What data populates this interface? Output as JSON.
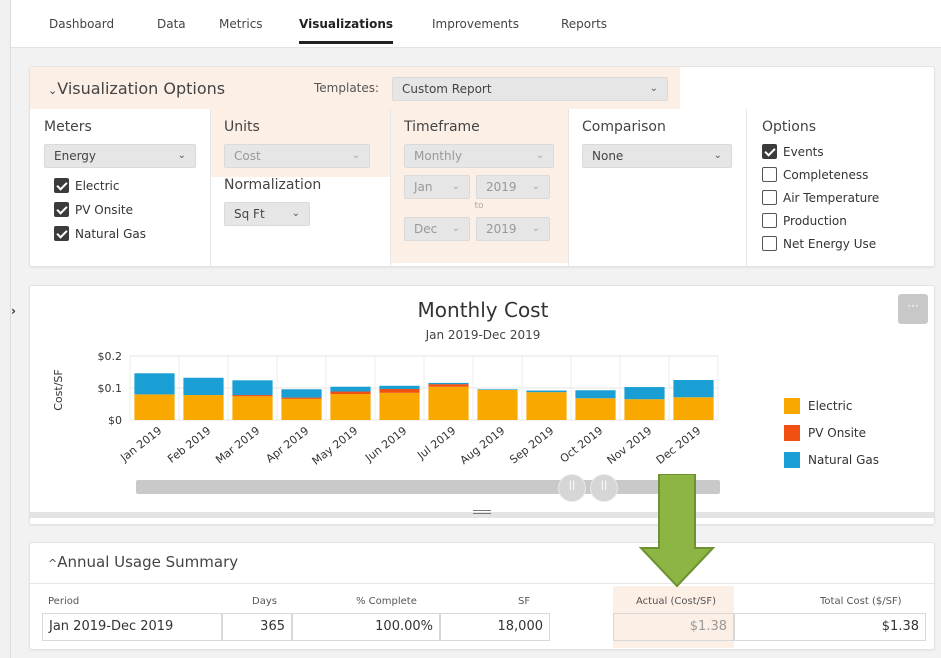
{
  "nav": {
    "tabs": [
      "Dashboard",
      "Data",
      "Metrics",
      "Visualizations",
      "Improvements",
      "Reports"
    ],
    "active": "Visualizations"
  },
  "viz_options": {
    "title": "Visualization Options",
    "templates_label": "Templates:",
    "template_value": "Custom Report",
    "meters": {
      "heading": "Meters",
      "select": "Energy",
      "items": [
        {
          "label": "Electric",
          "checked": true
        },
        {
          "label": "PV Onsite",
          "checked": true
        },
        {
          "label": "Natural Gas",
          "checked": true
        }
      ]
    },
    "units": {
      "heading": "Units",
      "select": "Cost"
    },
    "normalization": {
      "heading": "Normalization",
      "select": "Sq Ft"
    },
    "timeframe": {
      "heading": "Timeframe",
      "select": "Monthly",
      "from_month": "Jan",
      "from_year": "2019",
      "to_label": "to",
      "to_month": "Dec",
      "to_year": "2019"
    },
    "comparison": {
      "heading": "Comparison",
      "select": "None"
    },
    "options": {
      "heading": "Options",
      "items": [
        {
          "label": "Events",
          "checked": true
        },
        {
          "label": "Completeness",
          "checked": false
        },
        {
          "label": "Air Temperature",
          "checked": false
        },
        {
          "label": "Production",
          "checked": false
        },
        {
          "label": "Net Energy Use",
          "checked": false
        }
      ]
    }
  },
  "chart_card": {
    "menu_glyph": "···"
  },
  "chart_data": {
    "type": "bar",
    "stacked": true,
    "title": "Monthly Cost",
    "subtitle": "Jan 2019-Dec 2019",
    "ylabel": "Cost/SF",
    "xlabel": "",
    "ylim": [
      0,
      0.2
    ],
    "yticks": [
      {
        "value": 0,
        "label": "$0"
      },
      {
        "value": 0.1,
        "label": "$0.1"
      },
      {
        "value": 0.2,
        "label": "$0.2"
      }
    ],
    "categories": [
      "Jan 2019",
      "Feb 2019",
      "Mar 2019",
      "Apr 2019",
      "May 2019",
      "Jun 2019",
      "Jul 2019",
      "Aug 2019",
      "Sep 2019",
      "Oct 2019",
      "Nov 2019",
      "Dec 2019"
    ],
    "series": [
      {
        "name": "Electric",
        "color": "#f9a800",
        "values": [
          0.08,
          0.078,
          0.074,
          0.066,
          0.081,
          0.085,
          0.104,
          0.094,
          0.087,
          0.068,
          0.065,
          0.071
        ]
      },
      {
        "name": "PV Onsite",
        "color": "#f24f12",
        "values": [
          0.0,
          0.0,
          0.004,
          0.004,
          0.008,
          0.012,
          0.008,
          0.0,
          0.0,
          0.0,
          0.0,
          0.0
        ]
      },
      {
        "name": "Natural Gas",
        "color": "#1a9fd4",
        "values": [
          0.066,
          0.054,
          0.046,
          0.026,
          0.015,
          0.01,
          0.004,
          0.002,
          0.005,
          0.025,
          0.038,
          0.054
        ]
      }
    ],
    "legend_position": "right",
    "grid": true
  },
  "summary": {
    "title": "Annual Usage Summary",
    "columns": [
      "Period",
      "Days",
      "% Complete",
      "SF",
      "Actual (Cost/SF)",
      "Total Cost ($/SF)"
    ],
    "rows": [
      [
        "Jan 2019-Dec 2019",
        "365",
        "100.00%",
        "18,000",
        "$1.38",
        "$1.38"
      ]
    ]
  },
  "colors": {
    "highlight": "#fcefe6",
    "annotation_arrow": "#8db543"
  }
}
